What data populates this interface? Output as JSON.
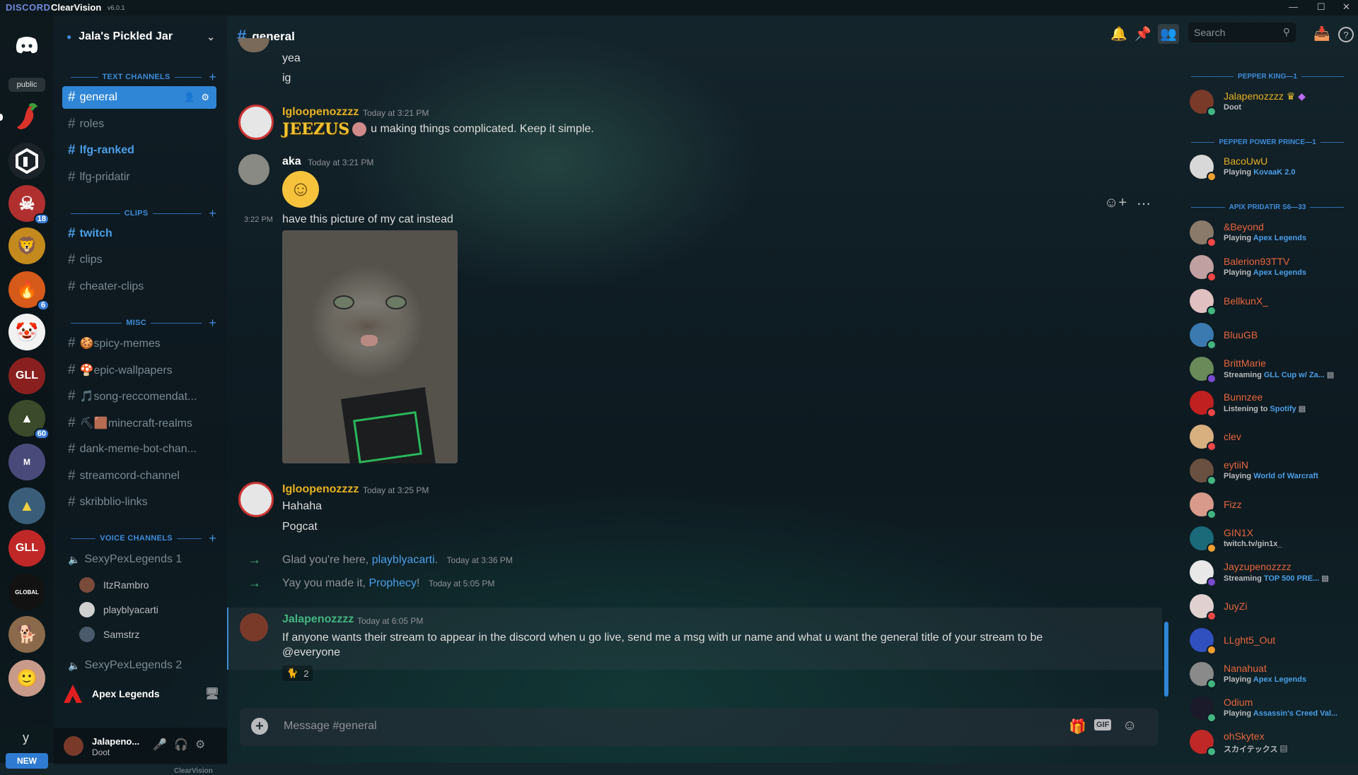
{
  "titlebar": {
    "brand": "DISCORD",
    "theme": "ClearVision",
    "version": "v6.0.1"
  },
  "guilds": {
    "public_label": "public",
    "badges": [
      "18",
      "6",
      "60"
    ],
    "new_label": "NEW",
    "y_label": "y"
  },
  "server": {
    "name": "Jala's Pickled Jar"
  },
  "categories": {
    "text": "TEXT CHANNELS",
    "clips": "CLIPS",
    "misc": "MISC",
    "voice": "VOICE CHANNELS"
  },
  "channels": {
    "text": [
      "general",
      "roles",
      "lfg-ranked",
      "lfg-pridatir"
    ],
    "clips": [
      "twitch",
      "clips",
      "cheater-clips"
    ],
    "misc": [
      "🍪spicy-memes",
      "🍄epic-wallpapers",
      "🎵song-reccomendat...",
      "⛏🟫minecraft-realms",
      "dank-meme-bot-chan...",
      "streamcord-channel",
      "skribblio-links"
    ]
  },
  "voice": {
    "channel1": "SexyPexLegends 1",
    "users": [
      "ItzRambro",
      "playblyacarti",
      "Samstrz"
    ],
    "channel2": "SexyPexLegends 2"
  },
  "activity_bar": {
    "game": "Apex Legends"
  },
  "user_panel": {
    "name": "Jalapeno...",
    "status": "Doot"
  },
  "footer": {
    "brand": "ClearVision"
  },
  "header": {
    "channel": "general",
    "search_placeholder": "Search"
  },
  "messages": {
    "m0": {
      "line1": "yea",
      "line2": "ig"
    },
    "m1": {
      "author": "Igloopenozzzz",
      "time": "Today at 3:21 PM",
      "jeezus": "JEEZUS",
      "text": "u making things complicated. Keep it simple."
    },
    "m2": {
      "author": "aka",
      "time": "Today at 3:21 PM",
      "side_time": "3:22 PM",
      "text": "have this picture of my cat instead"
    },
    "m3": {
      "author": "Igloopenozzzz",
      "time": "Today at 3:25 PM",
      "line1": "Hahaha",
      "line2": "Pogcat"
    },
    "sys1": {
      "prefix": "Glad you're here, ",
      "name": "playblyacarti",
      "suffix": ".",
      "time": "Today at 3:36 PM"
    },
    "sys2": {
      "prefix": "Yay you made it, ",
      "name": "Prophecy",
      "suffix": "!",
      "time": "Today at 5:05 PM"
    },
    "m4": {
      "author": "Jalapenozzzz",
      "time": "Today at 6:05 PM",
      "text": "If anyone wants their stream to appear in the discord when u go live, send me a msg with ur name and what u want the general title of your stream to be",
      "mention": "@everyone",
      "reaction_count": "2"
    }
  },
  "input": {
    "placeholder": "Message #general",
    "gif_label": "GIF"
  },
  "members": {
    "roles": [
      "PEPPER KING—1",
      "PEPPER POWER PRINCE—1",
      "APIX PRIDATIR S6—33"
    ],
    "list": [
      {
        "name": "Jalapenozzzz",
        "activity": "Doot",
        "highlight": ""
      },
      {
        "name": "BacoUwU",
        "activity": "Playing ",
        "highlight": "KovaaK 2.0"
      },
      {
        "name": "&Beyond",
        "activity": "Playing ",
        "highlight": "Apex Legends"
      },
      {
        "name": "Balerion93TTV",
        "activity": "Playing ",
        "highlight": "Apex Legends"
      },
      {
        "name": "BellkunX_",
        "activity": "",
        "highlight": ""
      },
      {
        "name": "BluuGB",
        "activity": "",
        "highlight": ""
      },
      {
        "name": "BrittMarie",
        "activity": "Streaming ",
        "highlight": "GLL Cup w/ Za..."
      },
      {
        "name": "Bunnzee",
        "activity": "Listening to ",
        "highlight": "Spotify"
      },
      {
        "name": "clev",
        "activity": "",
        "highlight": ""
      },
      {
        "name": "eytiiN",
        "activity": "Playing ",
        "highlight": "World of Warcraft"
      },
      {
        "name": "Fizz",
        "activity": "",
        "highlight": ""
      },
      {
        "name": "GIN1X",
        "activity": "twitch.tv/gin1x_",
        "highlight": ""
      },
      {
        "name": "Jayzupenozzzz",
        "activity": "Streaming ",
        "highlight": "TOP 500 PRE..."
      },
      {
        "name": "JuyZi",
        "activity": "",
        "highlight": ""
      },
      {
        "name": "LLght5_Out",
        "activity": "",
        "highlight": ""
      },
      {
        "name": "Nanahuat",
        "activity": "Playing ",
        "highlight": "Apex Legends"
      },
      {
        "name": "Odium",
        "activity": "Playing ",
        "highlight": "Assassin's Creed Val..."
      },
      {
        "name": "ohSkytex",
        "activity": "スカイテックス",
        "highlight": ""
      }
    ]
  },
  "colors": {
    "accent": "#2f86d6",
    "gold": "#f2c230",
    "green": "#43b581",
    "member_name": "#e8643c"
  }
}
